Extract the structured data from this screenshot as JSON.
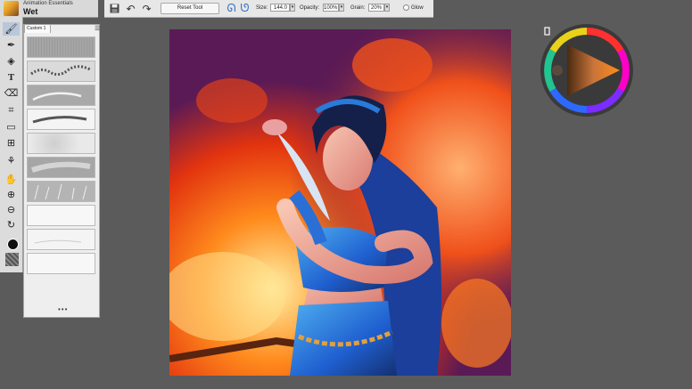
{
  "brush_selector": {
    "category": "Animation Essentials",
    "variant": "Wet"
  },
  "property_bar": {
    "reset_label": "Reset Tool",
    "size_label": "Size:",
    "size_value": "144.0",
    "opacity_label": "Opacity:",
    "opacity_value": "100%",
    "grain_label": "Grain:",
    "grain_value": "20%",
    "glow_label": "Glow"
  },
  "toolbox": {
    "tools": [
      "brush-tool",
      "dropper-tool",
      "fill-tool",
      "text-tool",
      "eraser-tool",
      "crop-tool",
      "rectangle-select-tool",
      "transform-tool",
      "shape-tool",
      "grabber-tool",
      "magnifier-tool",
      "zoom-out-tool",
      "rotate-page-tool"
    ]
  },
  "brush_panel": {
    "tab_label": "Custom 1",
    "menu_icon": "panel-menu-icon",
    "footer": "•••"
  },
  "colors": {
    "main_color": "#111111",
    "wheel_selected_hue": "#ff8c1a",
    "paper_color": "#ff9020"
  }
}
